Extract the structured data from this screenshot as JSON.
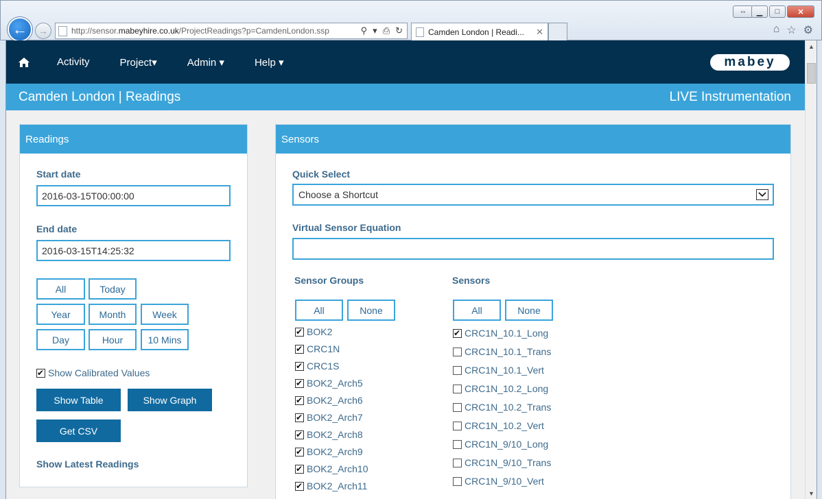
{
  "browser": {
    "url_prefix": "http://sensor.",
    "url_host": "mabeyhire.co.uk",
    "url_path": "/ProjectReadings?p=CamdenLondon.ssp",
    "tab_title": "Camden London | Readi..."
  },
  "nav": {
    "items": [
      {
        "label": "Activity"
      },
      {
        "label": "Project▾"
      },
      {
        "label": "Admin ▾"
      },
      {
        "label": "Help ▾"
      }
    ],
    "logo": "mabey"
  },
  "titlebar": {
    "title": "Camden London | Readings",
    "right": "LIVE Instrumentation"
  },
  "readings": {
    "heading": "Readings",
    "start_label": "Start date",
    "start_value": "2016-03-15T00:00:00",
    "end_label": "End date",
    "end_value": "2016-03-15T14:25:32",
    "range_buttons": [
      "All",
      "Today",
      "Year",
      "Month",
      "Week",
      "Day",
      "Hour",
      "10 Mins"
    ],
    "calibrated_label": "Show Calibrated Values",
    "calibrated_checked": true,
    "show_table": "Show Table",
    "show_graph": "Show Graph",
    "get_csv": "Get CSV",
    "latest": "Show Latest Readings"
  },
  "sensors": {
    "heading": "Sensors",
    "quick_select_label": "Quick Select",
    "quick_select_value": "Choose a Shortcut",
    "virtual_label": "Virtual Sensor Equation",
    "virtual_value": "",
    "groups_label": "Sensor Groups",
    "sensors_label": "Sensors",
    "all": "All",
    "none": "None",
    "groups": [
      {
        "name": "BOK2",
        "checked": true
      },
      {
        "name": "CRC1N",
        "checked": true
      },
      {
        "name": "CRC1S",
        "checked": true
      },
      {
        "name": "BOK2_Arch5",
        "checked": true
      },
      {
        "name": "BOK2_Arch6",
        "checked": true
      },
      {
        "name": "BOK2_Arch7",
        "checked": true
      },
      {
        "name": "BOK2_Arch8",
        "checked": true
      },
      {
        "name": "BOK2_Arch9",
        "checked": true
      },
      {
        "name": "BOK2_Arch10",
        "checked": true
      },
      {
        "name": "BOK2_Arch11",
        "checked": true
      }
    ],
    "sensor_list": [
      {
        "name": "CRC1N_10.1_Long",
        "checked": true
      },
      {
        "name": "CRC1N_10.1_Trans",
        "checked": false
      },
      {
        "name": "CRC1N_10.1_Vert",
        "checked": false
      },
      {
        "name": "CRC1N_10.2_Long",
        "checked": false
      },
      {
        "name": "CRC1N_10.2_Trans",
        "checked": false
      },
      {
        "name": "CRC1N_10.2_Vert",
        "checked": false
      },
      {
        "name": "CRC1N_9/10_Long",
        "checked": false
      },
      {
        "name": "CRC1N_9/10_Trans",
        "checked": false
      },
      {
        "name": "CRC1N_9/10_Vert",
        "checked": false
      }
    ]
  }
}
